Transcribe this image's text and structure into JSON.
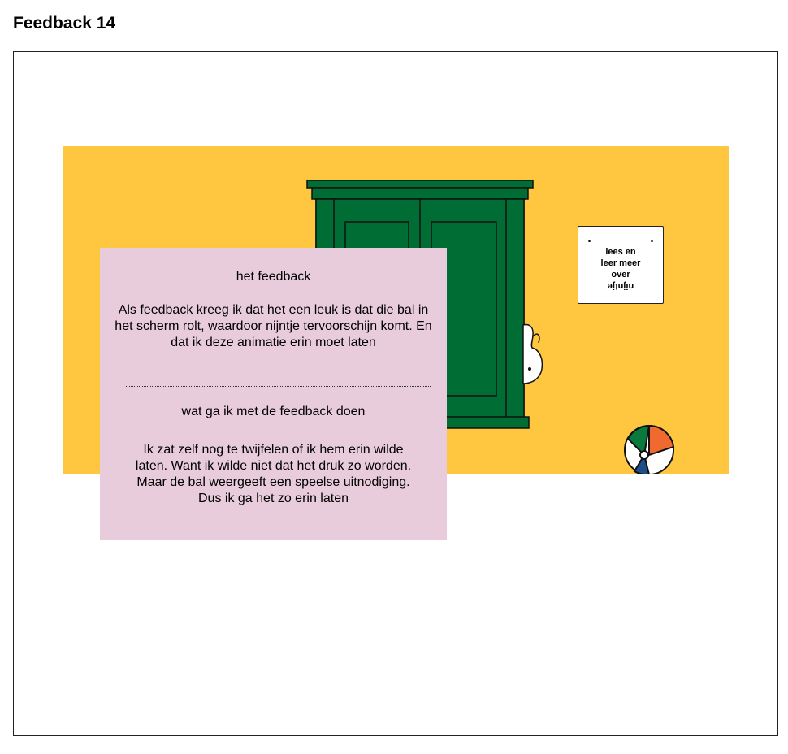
{
  "page": {
    "title": "Feedback 14"
  },
  "scene": {
    "sign": {
      "line1": "lees en",
      "line2": "leer meer",
      "line3": "over",
      "line4_flipped": "nijntje"
    },
    "icons": [
      "wardrobe-icon",
      "beach-ball-icon",
      "bunny-ear-icon"
    ],
    "colors": {
      "background": "#ffc73f",
      "wardrobe": "#006d35",
      "card": "#e9ccdb"
    }
  },
  "card": {
    "heading1": "het feedback",
    "body1": "Als feedback kreeg ik dat het een leuk is dat die bal in het scherm rolt, waardoor nijntje tervoorschijn komt. En dat ik deze animatie erin moet laten",
    "heading2": "wat ga ik met de feedback doen",
    "body2": "Ik zat zelf nog te twijfelen of ik hem erin wilde laten. Want ik wilde niet dat het druk zo worden. Maar de bal weergeeft een speelse uitnodiging. Dus ik ga het zo erin laten"
  }
}
